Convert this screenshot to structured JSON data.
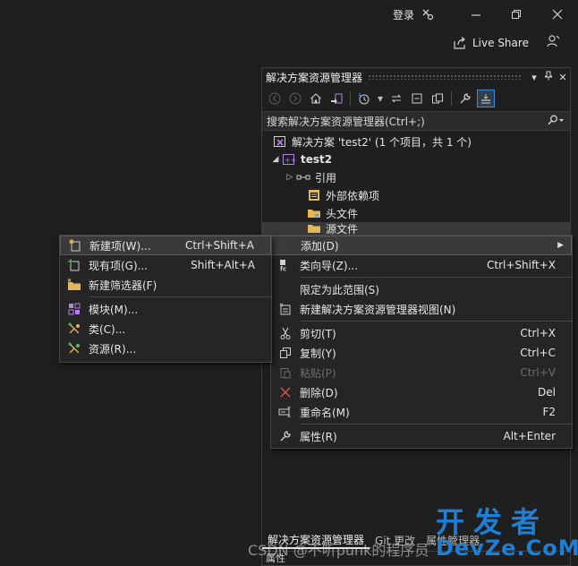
{
  "titlebar": {
    "login_label": "登录",
    "live_share_label": "Live Share",
    "icons": [
      "feedback-icon",
      "minimize-icon",
      "restore-icon",
      "close-icon",
      "live-share-icon",
      "person-icon"
    ]
  },
  "solution_explorer": {
    "title": "解决方案资源管理器",
    "search_placeholder": "搜索解决方案资源管理器(Ctrl+;)",
    "tree": {
      "solution_label": "解决方案 'test2' (1 个项目，共 1 个)",
      "project_label": "test2",
      "references_label": "引用",
      "external_deps_label": "外部依赖项",
      "header_files_label": "头文件",
      "source_files_label": "源文件"
    },
    "tabs": [
      "解决方案资源管理器",
      "Git 更改",
      "属性管理器"
    ],
    "properties_label": "属性"
  },
  "context_menu": {
    "items": [
      {
        "label": "添加(D)",
        "key": "",
        "submenu": true
      },
      {
        "label": "类向导(Z)...",
        "key": "Ctrl+Shift+X"
      },
      {
        "label": "限定为此范围(S)",
        "key": ""
      },
      {
        "label": "新建解决方案资源管理器视图(N)",
        "key": ""
      },
      {
        "label": "剪切(T)",
        "key": "Ctrl+X"
      },
      {
        "label": "复制(Y)",
        "key": "Ctrl+C"
      },
      {
        "label": "粘贴(P)",
        "key": "Ctrl+V",
        "disabled": true
      },
      {
        "label": "删除(D)",
        "key": "Del"
      },
      {
        "label": "重命名(M)",
        "key": "F2"
      },
      {
        "label": "属性(R)",
        "key": "Alt+Enter"
      }
    ]
  },
  "add_submenu": {
    "items": [
      {
        "label": "新建项(W)...",
        "key": "Ctrl+Shift+A"
      },
      {
        "label": "现有项(G)...",
        "key": "Shift+Alt+A"
      },
      {
        "label": "新建筛选器(F)",
        "key": ""
      },
      {
        "label": "模块(M)...",
        "key": ""
      },
      {
        "label": "类(C)...",
        "key": ""
      },
      {
        "label": "资源(R)...",
        "key": ""
      }
    ]
  },
  "watermark": {
    "text": "CSDN @不听punk的程序员",
    "logo_top": "开发者",
    "logo_bottom": "DevZe.CoM"
  },
  "colors": {
    "background": "#1f1f1f",
    "menu_bg": "#252526",
    "accent": "#3f8fd2",
    "logo": "#1f7fd4",
    "delete_red": "#e05252"
  }
}
